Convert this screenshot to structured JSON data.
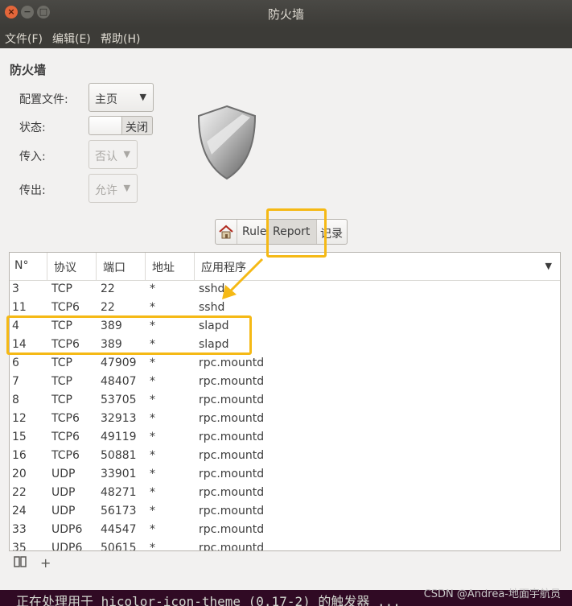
{
  "window": {
    "title": "防火墙"
  },
  "window_controls": {
    "close": "×",
    "minimize": "−",
    "maximize": "□"
  },
  "menubar": {
    "items": [
      "文件(F)",
      "编辑(E)",
      "帮助(H)"
    ]
  },
  "heading": "防火墙",
  "form": {
    "profile_label": "配置文件:",
    "profile_value": "主页",
    "status_label": "状态:",
    "status_value": "关闭",
    "incoming_label": "传入:",
    "incoming_value": "否认",
    "outgoing_label": "传出:",
    "outgoing_value": "允许"
  },
  "tabs": {
    "home_icon": "home-icon",
    "rules": "Rules",
    "report": "Report",
    "log": "记录"
  },
  "table": {
    "headers": [
      "N°",
      "协议",
      "端口",
      "地址",
      "应用程序"
    ],
    "rows": [
      [
        "3",
        "TCP",
        "22",
        "*",
        "sshd"
      ],
      [
        "11",
        "TCP6",
        "22",
        "*",
        "sshd"
      ],
      [
        "4",
        "TCP",
        "389",
        "*",
        "slapd"
      ],
      [
        "14",
        "TCP6",
        "389",
        "*",
        "slapd"
      ],
      [
        "6",
        "TCP",
        "47909",
        "*",
        "rpc.mountd"
      ],
      [
        "7",
        "TCP",
        "48407",
        "*",
        "rpc.mountd"
      ],
      [
        "8",
        "TCP",
        "53705",
        "*",
        "rpc.mountd"
      ],
      [
        "12",
        "TCP6",
        "32913",
        "*",
        "rpc.mountd"
      ],
      [
        "15",
        "TCP6",
        "49119",
        "*",
        "rpc.mountd"
      ],
      [
        "16",
        "TCP6",
        "50881",
        "*",
        "rpc.mountd"
      ],
      [
        "20",
        "UDP",
        "33901",
        "*",
        "rpc.mountd"
      ],
      [
        "22",
        "UDP",
        "48271",
        "*",
        "rpc.mountd"
      ],
      [
        "24",
        "UDP",
        "56173",
        "*",
        "rpc.mountd"
      ],
      [
        "33",
        "UDP6",
        "44547",
        "*",
        "rpc.mountd"
      ],
      [
        "35",
        "UDP6",
        "50615",
        "*",
        "rpc.mountd"
      ]
    ]
  },
  "bottombar": {
    "columns_icon": "columns-icon",
    "add_label": "+"
  },
  "terminal": {
    "text": "正在处理用于 hicolor-icon-theme (0.17-2) 的触发器 ..."
  },
  "watermark": "CSDN @Andrea-地面宇航员",
  "colors": {
    "highlight": "#f5b915",
    "titlebar": "#3c3b37",
    "close_button": "#e3663a"
  }
}
